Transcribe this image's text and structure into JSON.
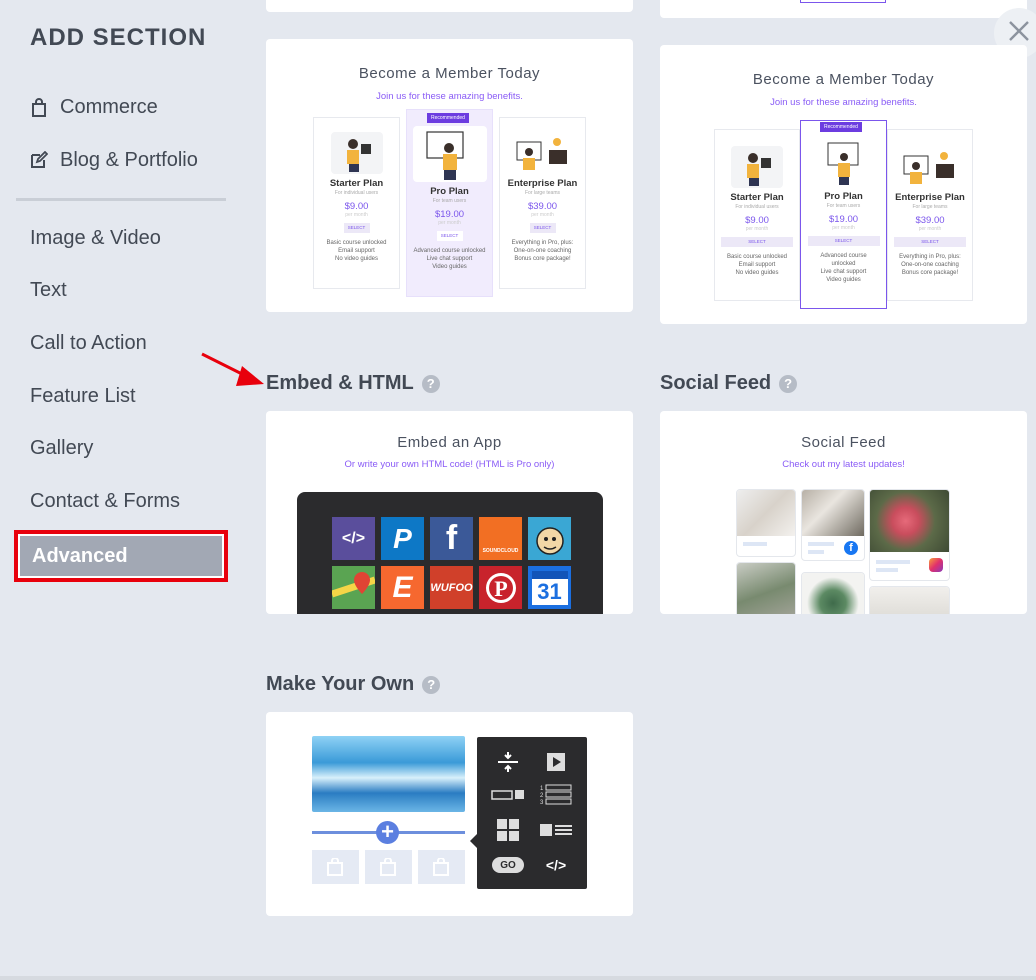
{
  "sidebar": {
    "title": "ADD SECTION",
    "items": [
      {
        "label": "Commerce",
        "icon": "shopping-bag-icon"
      },
      {
        "label": "Blog & Portfolio",
        "icon": "edit-icon"
      },
      {
        "label": "Image & Video"
      },
      {
        "label": "Text"
      },
      {
        "label": "Call to Action"
      },
      {
        "label": "Feature List"
      },
      {
        "label": "Gallery"
      },
      {
        "label": "Contact & Forms"
      },
      {
        "label": "Advanced",
        "selected": true
      }
    ]
  },
  "membership_cards": [
    {
      "title": "Become a Member Today",
      "subtitle": "Join us for these amazing benefits.",
      "badge": "Recommended",
      "plans": [
        {
          "name": "Starter Plan",
          "for": "For individual users",
          "price": "$9.00",
          "per": "per month",
          "select": "SELECT",
          "features": [
            "Basic course unlocked",
            "Email support",
            "No video guides"
          ]
        },
        {
          "name": "Pro Plan",
          "for": "For team users",
          "price": "$19.00",
          "per": "per month",
          "select": "SELECT",
          "features": [
            "Advanced course unlocked",
            "Live chat support",
            "Video guides"
          ]
        },
        {
          "name": "Enterprise Plan",
          "for": "For large teams",
          "price": "$39.00",
          "per": "per month",
          "select": "SELECT",
          "features": [
            "Everything in Pro, plus:",
            "One-on-one coaching",
            "Bonus core package!"
          ]
        }
      ]
    },
    {
      "title": "Become a Member Today",
      "subtitle": "Join us for these amazing benefits.",
      "badge": "Recommended",
      "plans": [
        {
          "name": "Starter Plan",
          "for": "For individual users",
          "price": "$9.00",
          "per": "per month",
          "select": "SELECT",
          "features": [
            "Basic course unlocked",
            "Email support",
            "No video guides"
          ]
        },
        {
          "name": "Pro Plan",
          "for": "For team users",
          "price": "$19.00",
          "per": "per month",
          "select": "SELECT",
          "features": [
            "Advanced course",
            "unlocked",
            "Live chat support",
            "Video guides"
          ]
        },
        {
          "name": "Enterprise Plan",
          "for": "For large teams",
          "price": "$39.00",
          "per": "per month",
          "select": "SELECT",
          "features": [
            "Everything in Pro, plus:",
            "One-on-one coaching",
            "Bonus core package!"
          ]
        }
      ]
    }
  ],
  "sections": {
    "embed": {
      "heading": "Embed & HTML",
      "card_title": "Embed an App",
      "card_subtitle": "Or write your own HTML code! (HTML is Pro only)",
      "apps": [
        {
          "icon": "code-icon",
          "label": "</>",
          "color": "#5a4e9c"
        },
        {
          "icon": "paypal-icon",
          "label": "P",
          "color": "#0d78c6"
        },
        {
          "icon": "facebook-icon",
          "label": "f",
          "color": "#3b5998"
        },
        {
          "icon": "soundcloud-icon",
          "label": "SOUNDCLOUD",
          "color": "#f26f23"
        },
        {
          "icon": "mailchimp-icon",
          "label": "",
          "color": "#3aa7d4"
        },
        {
          "icon": "google-maps-icon",
          "label": "",
          "color": "#5aa452"
        },
        {
          "icon": "eventbrite-icon",
          "label": "E",
          "color": "#f6682f"
        },
        {
          "icon": "wufoo-icon",
          "label": "WUFOO",
          "color": "#d0402a"
        },
        {
          "icon": "pinterest-icon",
          "label": "P",
          "color": "#c8232c"
        },
        {
          "icon": "calendar-icon",
          "label": "31",
          "color": "#1b6fe0"
        }
      ]
    },
    "social": {
      "heading": "Social Feed",
      "card_title": "Social Feed",
      "card_subtitle": "Check out my latest updates!"
    },
    "make_your_own": {
      "heading": "Make Your Own",
      "tools": [
        {
          "icon": "spacer-icon"
        },
        {
          "icon": "video-icon"
        },
        {
          "icon": "button-layout-icon"
        },
        {
          "icon": "numbered-list-icon"
        },
        {
          "icon": "gallery-icon"
        },
        {
          "icon": "image-text-icon"
        },
        {
          "icon": "go-button-icon",
          "label": "GO"
        },
        {
          "icon": "code-icon",
          "label": "</>"
        }
      ]
    }
  },
  "help_label": "?",
  "colors": {
    "background": "#e4e8ef",
    "accent_purple": "#7b56ec",
    "highlight_red": "#e8000c",
    "selected_item": "#a2a8b4"
  }
}
